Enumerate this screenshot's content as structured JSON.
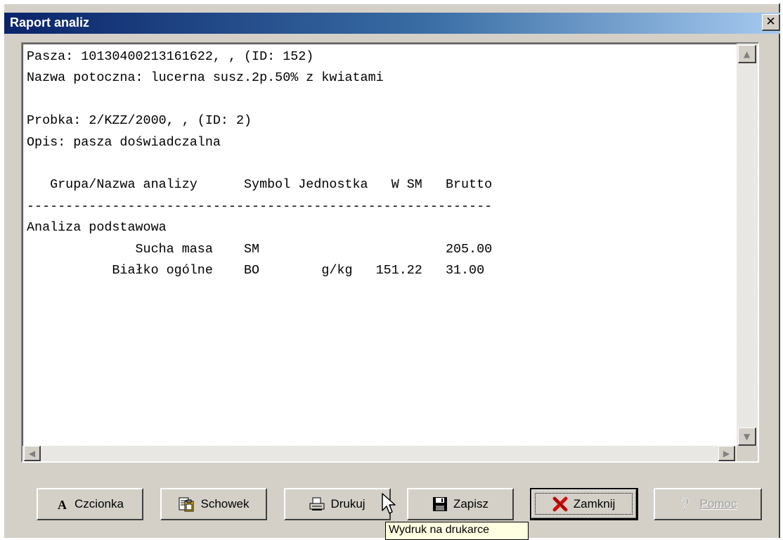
{
  "window": {
    "title": "Raport analiz",
    "close_glyph": "✕"
  },
  "report": {
    "lines": [
      "Pasza: 10130400213161622, , (ID: 152)",
      "Nazwa potoczna: lucerna susz.2p.50% z kwiatami",
      "",
      "Probka: 2/KZZ/2000, , (ID: 2)",
      "Opis: pasza doświadczalna",
      "",
      "   Grupa/Nazwa analizy      Symbol Jednostka   W SM   Brutto",
      "------------------------------------------------------------",
      "Analiza podstawowa",
      "              Sucha masa    SM                        205.00",
      "           Białko ogólne    BO        g/kg   151.22   31.00"
    ]
  },
  "buttons": {
    "font": {
      "label": "Czcionka",
      "icon": "letter-a-icon"
    },
    "clipboard": {
      "label": "Schowek",
      "icon": "clipboard-icon"
    },
    "print": {
      "label": "Drukuj",
      "icon": "printer-icon"
    },
    "save": {
      "label": "Zapisz",
      "icon": "floppy-disk-icon"
    },
    "close": {
      "label": "Zamknij",
      "icon": "red-x-icon"
    },
    "help": {
      "label": "Pomoc",
      "icon": "question-mark-icon",
      "enabled": false
    }
  },
  "tooltip": {
    "text": "Wydruk na drukarce"
  },
  "colors": {
    "title_gradient_start": "#0a246a",
    "title_gradient_end": "#a6caf0",
    "face": "#d4d0c8",
    "tooltip_bg": "#ffffe1",
    "close_icon": "#cc1010"
  }
}
